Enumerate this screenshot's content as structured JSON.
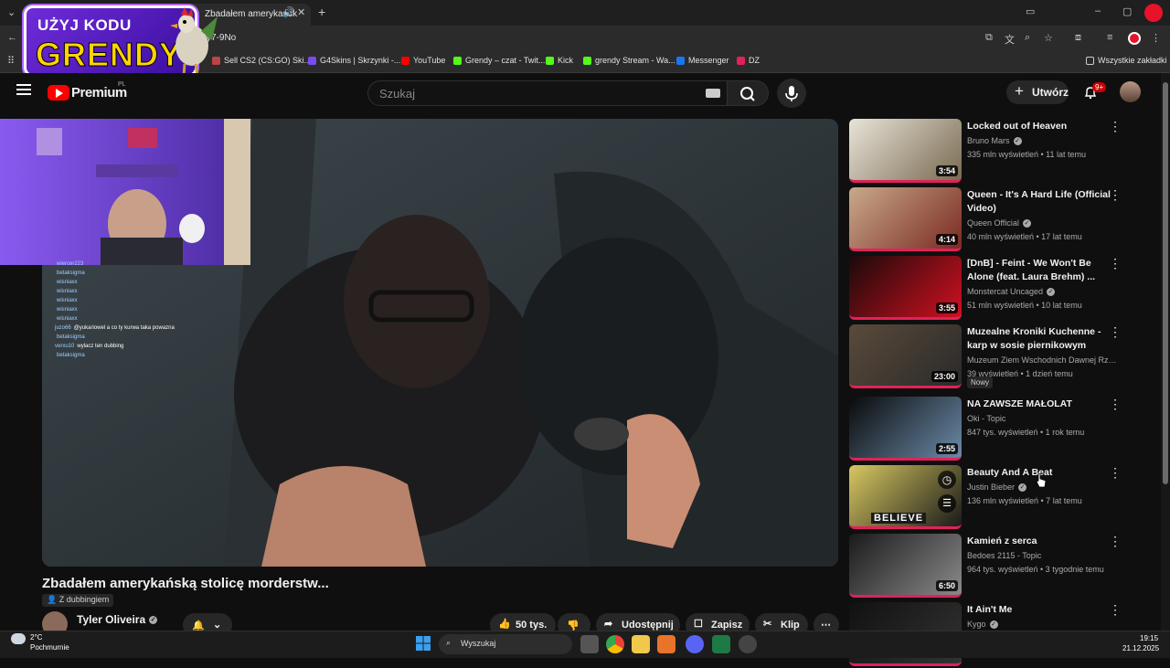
{
  "browser": {
    "tab_title": "Zbadałem amerykańsk",
    "url_fragment": "y7-9No",
    "bookmarks": [
      {
        "label": "Sell CS2 (CS:GO) Ski...",
        "color": "#b44"
      },
      {
        "label": "G4Skins | Skrzynki -...",
        "color": "#7a4cf0"
      },
      {
        "label": "YouTube",
        "color": "#ff0000"
      },
      {
        "label": "Grendy – czat - Twit...",
        "color": "#53fc18"
      },
      {
        "label": "Kick",
        "color": "#53fc18"
      },
      {
        "label": "grendy Stream - Wa...",
        "color": "#53fc18"
      },
      {
        "label": "Messenger",
        "color": "#1877f2"
      },
      {
        "label": "DZ",
        "color": "#e0225a"
      }
    ],
    "all_bookmarks_label": "Wszystkie zakładki"
  },
  "promo": {
    "line1": "UŻYJ KODU",
    "line2": "GRENDY"
  },
  "youtube": {
    "logo_text": "Premium",
    "logo_region": "PL",
    "search_placeholder": "Szukaj",
    "create_label": "Utwórz",
    "notifications_badge": "9+"
  },
  "stream_chat": [
    {
      "user": "wiercer223",
      "msg": ""
    },
    {
      "user": "betaksigma",
      "msg": ""
    },
    {
      "user": "wisniaxx",
      "msg": ""
    },
    {
      "user": "wisniaxx",
      "msg": ""
    },
    {
      "user": "wisniaxx",
      "msg": ""
    },
    {
      "user": "wisniaxx",
      "msg": ""
    },
    {
      "user": "wisniaxx",
      "msg": ""
    },
    {
      "user": "juzo66",
      "msg": "@yukariowel a co ty kurwa taka powazna"
    },
    {
      "user": "betaksigma",
      "msg": ""
    },
    {
      "user": "verxu10",
      "msg": "wylacz ten dubbing"
    },
    {
      "user": "betaksigma",
      "msg": ""
    }
  ],
  "video": {
    "title": "Zbadałem amerykańską stolicę morderstw...",
    "dubbing_label": "Z dubbingiem",
    "channel": "Tyler Oliveira",
    "likes": "50 tys.",
    "share_label": "Udostępnij",
    "save_label": "Zapisz",
    "clip_label": "Klip"
  },
  "recommendations": [
    {
      "title": "Locked out of Heaven",
      "channel": "Bruno Mars",
      "verified": true,
      "meta": "335 mln wyświetleń • 11 lat temu",
      "duration": "3:54",
      "thumb_colors": [
        "#e8e4d8",
        "#7a6a52"
      ]
    },
    {
      "title": "Queen - It's A Hard Life (Official Video)",
      "channel": "Queen Official",
      "verified": true,
      "meta": "40 mln wyświetleń • 17 lat temu",
      "duration": "4:14",
      "thumb_colors": [
        "#c9a98a",
        "#7a2a22"
      ]
    },
    {
      "title": "[DnB] - Feint - We Won't Be Alone (feat. Laura Brehm) ...",
      "channel": "Monstercat Uncaged",
      "verified": true,
      "meta": "51 mln wyświetleń • 10 lat temu",
      "duration": "3:55",
      "thumb_colors": [
        "#1a0a0a",
        "#d01020"
      ]
    },
    {
      "title": "Muzealne Kroniki Kuchenne - karp w sosie piernikowym",
      "channel": "Muzeum Ziem Wschodnich Dawnej Rzec...",
      "verified": false,
      "meta": "39 wyświetleń • 1 dzień temu",
      "duration": "23:00",
      "badge": "Nowy",
      "thumb_colors": [
        "#5a4a3a",
        "#2a2a2a"
      ]
    },
    {
      "title": "NA ZAWSZE MAŁOLAT",
      "channel": "Oki - Topic",
      "verified": false,
      "meta": "847 tys. wyświetleń • 1 rok temu",
      "duration": "2:55",
      "thumb_colors": [
        "#0a0a0a",
        "#6a8aa8"
      ]
    },
    {
      "title": "Beauty And A Beat",
      "channel": "Justin Bieber",
      "verified": true,
      "meta": "136 mln wyświetleń • 7 lat temu",
      "duration": "",
      "thumb_label": "BELIEVE",
      "thumb_colors": [
        "#d8c860",
        "#1a1a1a"
      ]
    },
    {
      "title": "Kamień z serca",
      "channel": "Bedoes 2115 - Topic",
      "verified": false,
      "meta": "964 tys. wyświetleń • 3 tygodnie temu",
      "duration": "6:50",
      "thumb_colors": [
        "#1a1a1a",
        "#8a8a8a"
      ]
    },
    {
      "title": "It Ain't Me",
      "channel": "Kygo",
      "verified": true,
      "meta": "",
      "duration": "",
      "thumb_colors": [
        "#111111",
        "#333333"
      ]
    }
  ],
  "taskbar": {
    "weather_temp": "2°C",
    "weather_desc": "Pochmurnie",
    "search_label": "Wyszukaj",
    "time": "19:15",
    "date": "21.12.2025"
  }
}
